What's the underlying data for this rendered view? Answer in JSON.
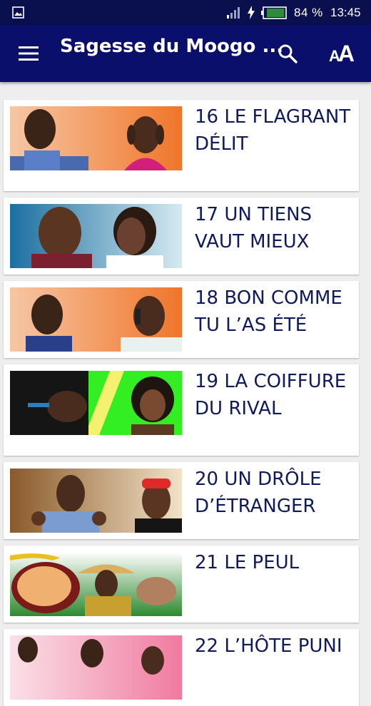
{
  "status_bar": {
    "battery": "84 %",
    "battery_level": 0.84,
    "time": "13:45",
    "icons": [
      "image-icon",
      "signal-icon",
      "charging-bolt-icon",
      "battery-icon"
    ]
  },
  "app_bar": {
    "title": "Sagesse du Moogo ...",
    "menu_icon": "hamburger-menu-icon",
    "search_icon": "search-icon",
    "font_size_icon": "font-size-icon",
    "font_size_small": "A",
    "font_size_large": "A"
  },
  "colors": {
    "status_bar": "#0a0f4e",
    "app_bar": "#0a0f6b",
    "title_text": "#0f1a5c",
    "background": "#eeeeee"
  },
  "episodes": [
    {
      "title": "16 LE FLAGRANT DÉLIT",
      "thumb_bg": "#f0752a"
    },
    {
      "title": "17 UN TIENS VAUT MIEUX",
      "thumb_bg": "#2a8fc0"
    },
    {
      "title": "18 BON COMME TU L’AS ÉTÉ",
      "thumb_bg": "#f0752a"
    },
    {
      "title": "19 LA COIFFURE DU RIVAL",
      "thumb_bg": "#33ee22"
    },
    {
      "title": "20 UN DRÔLE D’ÉTRANGER",
      "thumb_bg": "#a86a2e"
    },
    {
      "title": "21 LE PEUL",
      "thumb_bg": "#3d9a3a"
    },
    {
      "title": "22 L’HÔTE PUNI",
      "thumb_bg": "#f07aa0"
    }
  ]
}
